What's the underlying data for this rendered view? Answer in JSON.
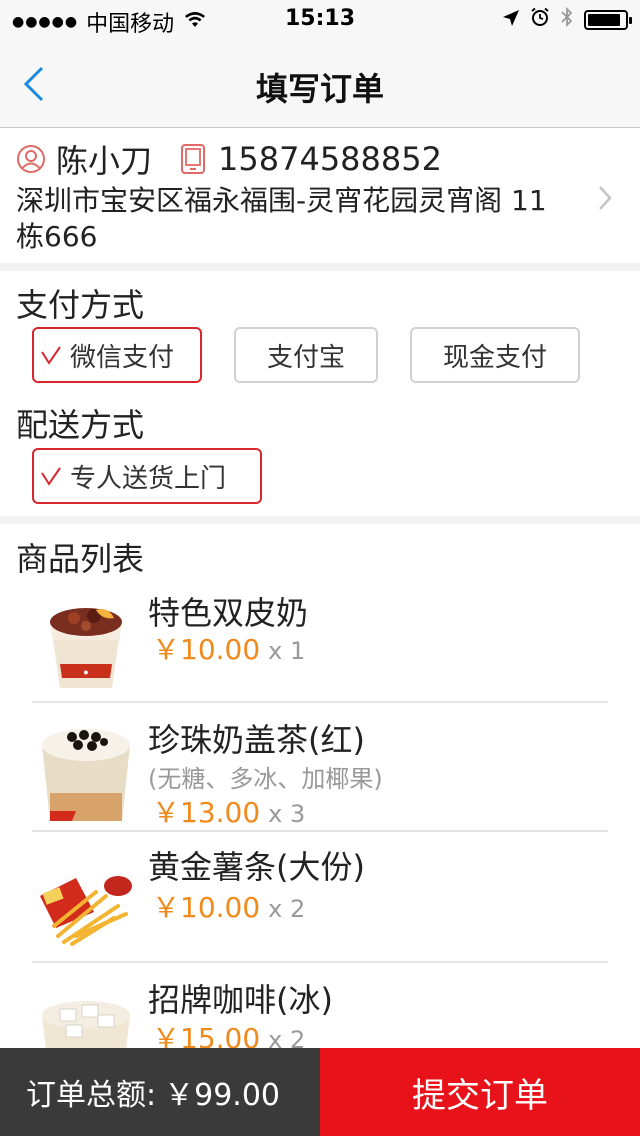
{
  "status_bar": {
    "carrier": "中国移动",
    "time": "15:13",
    "battery_level": 0.9
  },
  "nav": {
    "title": "填写订单",
    "back_icon": "chevron-left-icon"
  },
  "address": {
    "name": "陈小刀",
    "phone": "15874588852",
    "line1": "深圳市宝安区福永福围-灵宵花园灵宵阁 11",
    "line2": "栋666"
  },
  "payment": {
    "title": "支付方式",
    "options": [
      {
        "label": "微信支付",
        "selected": true
      },
      {
        "label": "支付宝",
        "selected": false
      },
      {
        "label": "现金支付",
        "selected": false
      }
    ]
  },
  "delivery": {
    "title": "配送方式",
    "options": [
      {
        "label": "专人送货上门",
        "selected": true
      }
    ]
  },
  "products": {
    "title": "商品列表",
    "items": [
      {
        "name": "特色双皮奶",
        "note": "",
        "price": "￥10.00",
        "qty": "x 1"
      },
      {
        "name": "珍珠奶盖茶(红)",
        "note": "(无糖、多冰、加椰果)",
        "price": "￥13.00",
        "qty": "x 3"
      },
      {
        "name": "黄金薯条(大份)",
        "note": "",
        "price": "￥10.00",
        "qty": "x 2"
      },
      {
        "name": "招牌咖啡(冰)",
        "note": "",
        "price": "￥15.00",
        "qty": "x 2"
      }
    ]
  },
  "footer": {
    "total_label": "订单总额:",
    "total_value": "￥99.00",
    "submit_label": "提交订单"
  },
  "colors": {
    "accent_red": "#e8131a",
    "price_orange": "#f08a1c",
    "footer_dark": "#3a3a3a"
  }
}
